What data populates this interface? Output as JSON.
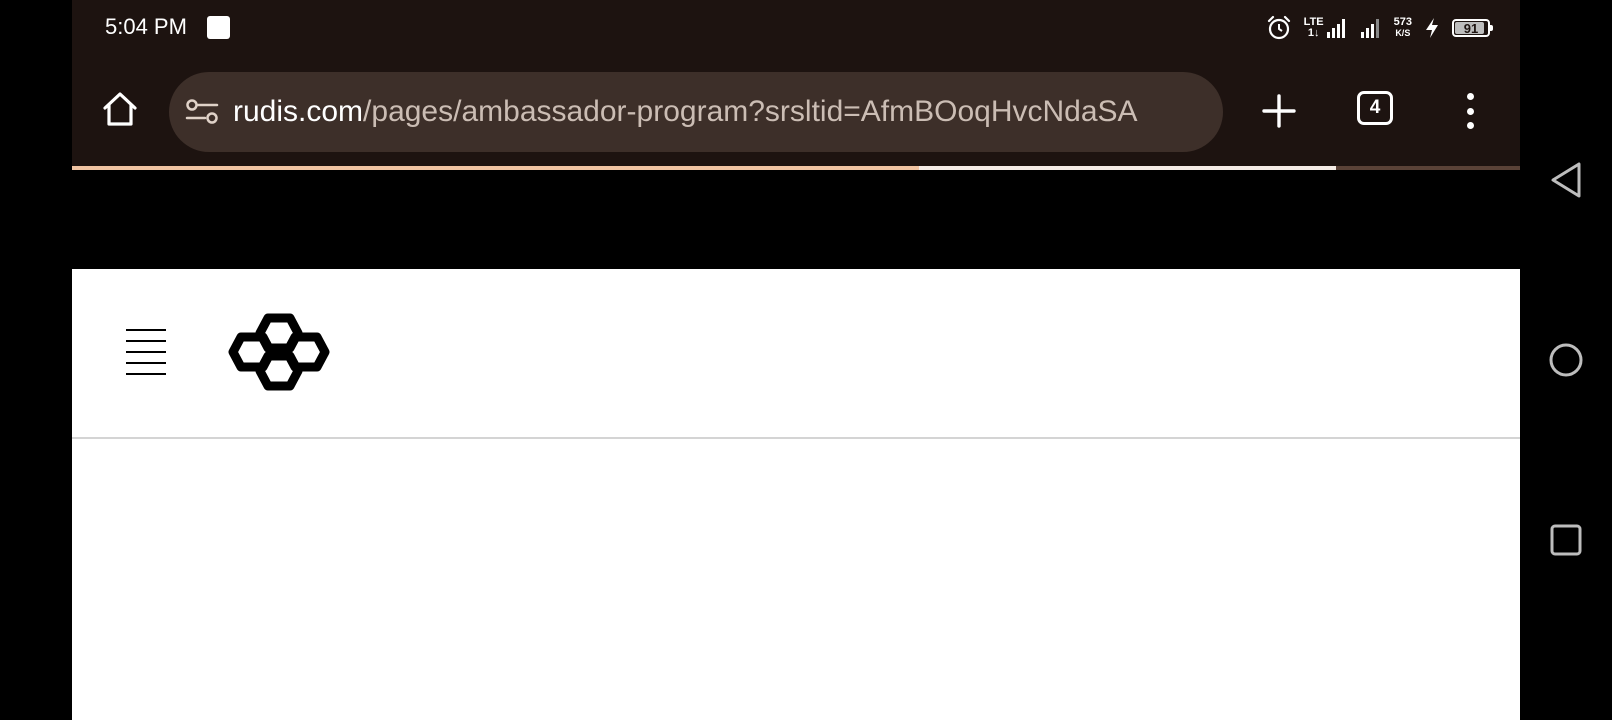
{
  "status_bar": {
    "time": "5:04 PM",
    "lte_top": "LTE",
    "lte_bottom": "1↓",
    "speed_value": "573",
    "speed_unit": "K/S",
    "battery_level": "91",
    "battery_fraction": 0.91
  },
  "browser": {
    "url_domain": "rudis.com",
    "url_path": "/pages/ambassador-program?srsltid=AfmBOoqHvcNdaSA",
    "tab_count": "4",
    "load_progress": 0.585,
    "load_progress_secondary": 0.873
  },
  "icons": {
    "home": "home-icon",
    "site_settings": "site-settings-icon",
    "new_tab": "plus-icon",
    "tabs": "tab-switcher-icon",
    "menu": "more-vert-icon",
    "hamburger": "hamburger-menu-icon",
    "logo": "hexagon-cluster-logo",
    "nav_back": "back-triangle-icon",
    "nav_home": "home-circle-icon",
    "nav_recents": "recents-square-icon"
  },
  "colors": {
    "chrome_background": "#1d1310",
    "url_bar_background": "#3d2f29",
    "progress_primary": "#f0c3a2",
    "progress_secondary": "#f5ece6"
  }
}
